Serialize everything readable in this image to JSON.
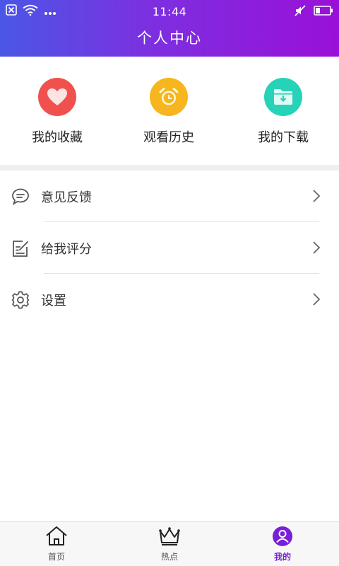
{
  "status_bar": {
    "time": "11:44",
    "icons": [
      "close-notification-icon",
      "wifi-icon",
      "more-dots-icon",
      "mute-icon",
      "battery-icon"
    ]
  },
  "header": {
    "title": "个人中心",
    "gradient_colors": [
      "#4a57e6",
      "#9a10d8"
    ]
  },
  "quick_actions": [
    {
      "label": "我的收藏",
      "icon": "heart-icon",
      "color": "#f0514f"
    },
    {
      "label": "观看历史",
      "icon": "alarm-clock-icon",
      "color": "#f7b51e"
    },
    {
      "label": "我的下载",
      "icon": "download-folder-icon",
      "color": "#27d3b8"
    }
  ],
  "menu": [
    {
      "label": "意见反馈",
      "icon": "chat-bubble-icon"
    },
    {
      "label": "给我评分",
      "icon": "edit-note-icon"
    },
    {
      "label": "设置",
      "icon": "gear-icon"
    }
  ],
  "tabbar": {
    "tabs": [
      {
        "label": "首页",
        "icon": "home-icon",
        "active": false
      },
      {
        "label": "热点",
        "icon": "crown-icon",
        "active": false
      },
      {
        "label": "我的",
        "icon": "user-avatar-icon",
        "active": true
      }
    ],
    "active_color": "#7a1fd8"
  }
}
